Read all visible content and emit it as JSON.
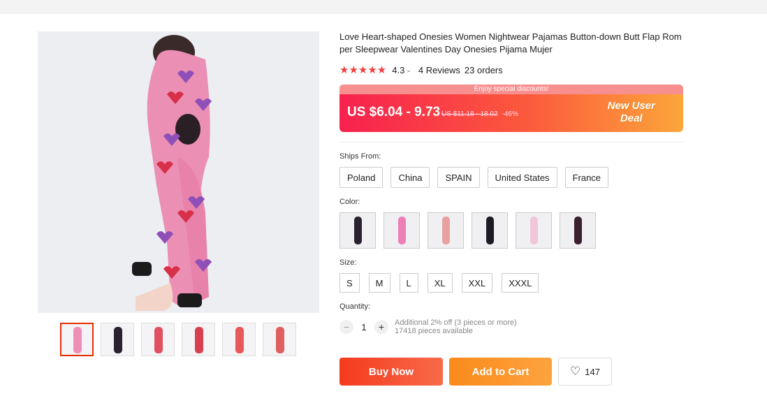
{
  "product": {
    "title": "Love Heart-shaped Onesies Women Nightwear Pajamas Button-down Butt Flap Rom per Sleepwear Valentines Day Onesies Pijama Mujer",
    "stars": "★★★★★",
    "rating": "4.3",
    "rating_chevron": "⌄",
    "reviews": "4 Reviews",
    "orders": "23 orders"
  },
  "promo": {
    "enjoy": "Enjoy special discounts!",
    "price": "US $6.04 - 9.73",
    "old_price": "US $11.18 - 18.02",
    "discount": "-46%",
    "new_user_line1": "New User",
    "new_user_line2": "Deal"
  },
  "ships_from": {
    "label": "Ships From:",
    "options": [
      "Poland",
      "China",
      "SPAIN",
      "United States",
      "France"
    ]
  },
  "color": {
    "label": "Color:",
    "swatch_colors": [
      "#2a2230",
      "#ee7fb6",
      "#f2f2f2",
      "#1c1c24",
      "#f1c6d8",
      "#3a2030"
    ]
  },
  "size": {
    "label": "Size:",
    "options": [
      "S",
      "M",
      "L",
      "XL",
      "XXL",
      "XXXL"
    ]
  },
  "quantity": {
    "label": "Quantity:",
    "minus": "−",
    "value": "1",
    "plus": "+",
    "note_line1": "Additional 2% off (3 pieces or more)",
    "note_line2": "17418 pieces available"
  },
  "actions": {
    "buy_now": "Buy Now",
    "add_to_cart": "Add to Cart",
    "wishlist_icon": "♡",
    "wishlist_count": "147"
  },
  "thumbnails": {
    "colors": [
      "#ef8fb8",
      "#2a2230",
      "#f5e8e8",
      "#f0dede",
      "#f8ecec",
      "#f8eeee"
    ]
  }
}
